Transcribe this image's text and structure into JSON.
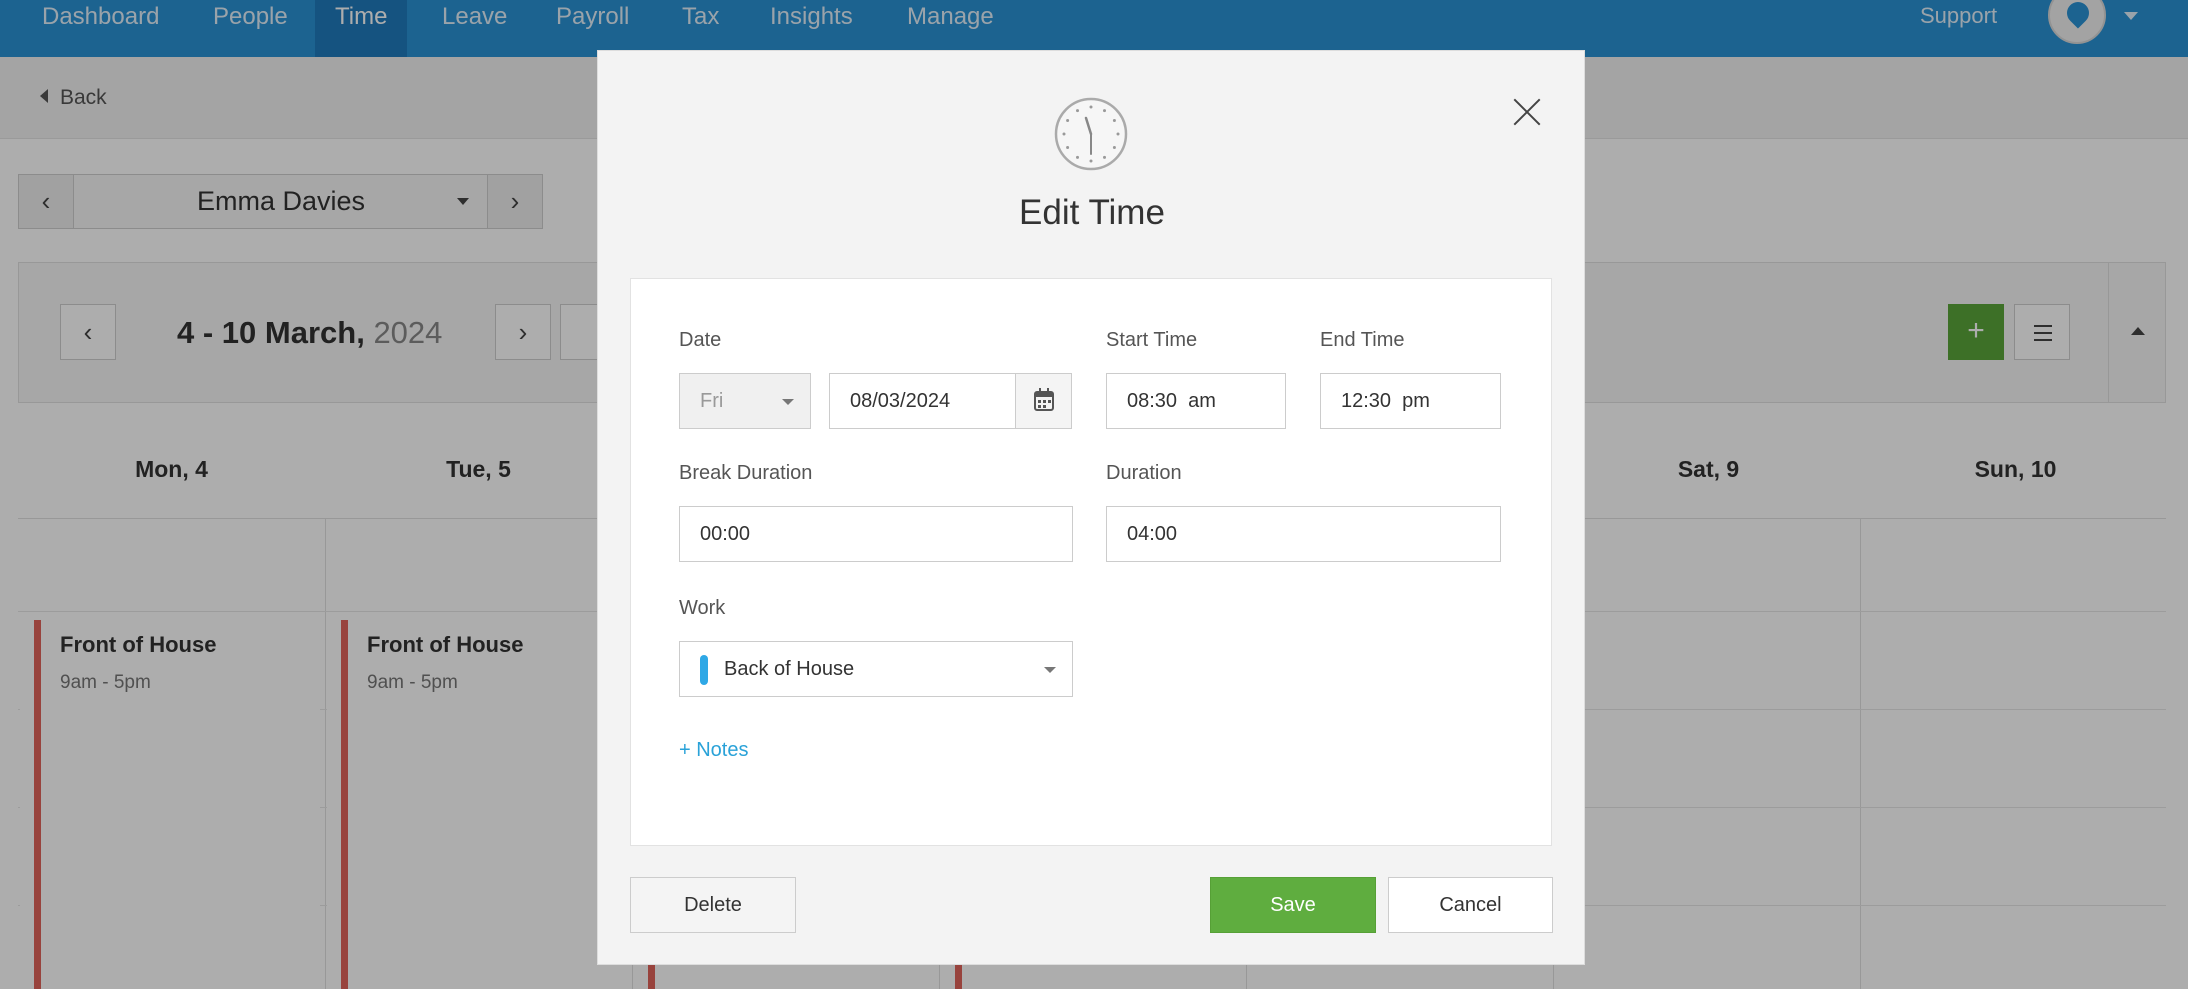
{
  "nav": {
    "items": [
      "Dashboard",
      "People",
      "Time",
      "Leave",
      "Payroll",
      "Tax",
      "Insights",
      "Manage"
    ],
    "active": "Time",
    "support": "Support"
  },
  "back_label": "Back",
  "employee": {
    "name": "Emma Davies"
  },
  "week": {
    "range": "4 - 10 March,",
    "year": "2024"
  },
  "add_label": "+",
  "days": [
    "Mon, 4",
    "Tue, 5",
    "Sat, 9",
    "Sun, 10"
  ],
  "shifts": [
    {
      "title": "Front of House",
      "time": "9am - 5pm"
    },
    {
      "title": "Front of House",
      "time": "9am - 5pm"
    }
  ],
  "modal": {
    "title": "Edit Time",
    "date_label": "Date",
    "day_value": "Fri",
    "date_value": "08/03/2024",
    "start_label": "Start Time",
    "start_value": "08:30  am",
    "end_label": "End Time",
    "end_value": "12:30  pm",
    "break_label": "Break Duration",
    "break_value": "00:00",
    "duration_label": "Duration",
    "duration_value": "04:00",
    "work_label": "Work",
    "work_value": "Back of House",
    "work_color": "#2fa8e6",
    "notes_link": "+ Notes",
    "delete_label": "Delete",
    "save_label": "Save",
    "cancel_label": "Cancel"
  },
  "colors": {
    "nav": "#2a92d5",
    "save": "#5fad3f",
    "shift_bar": "#e0645b",
    "link": "#2aa2d8"
  }
}
